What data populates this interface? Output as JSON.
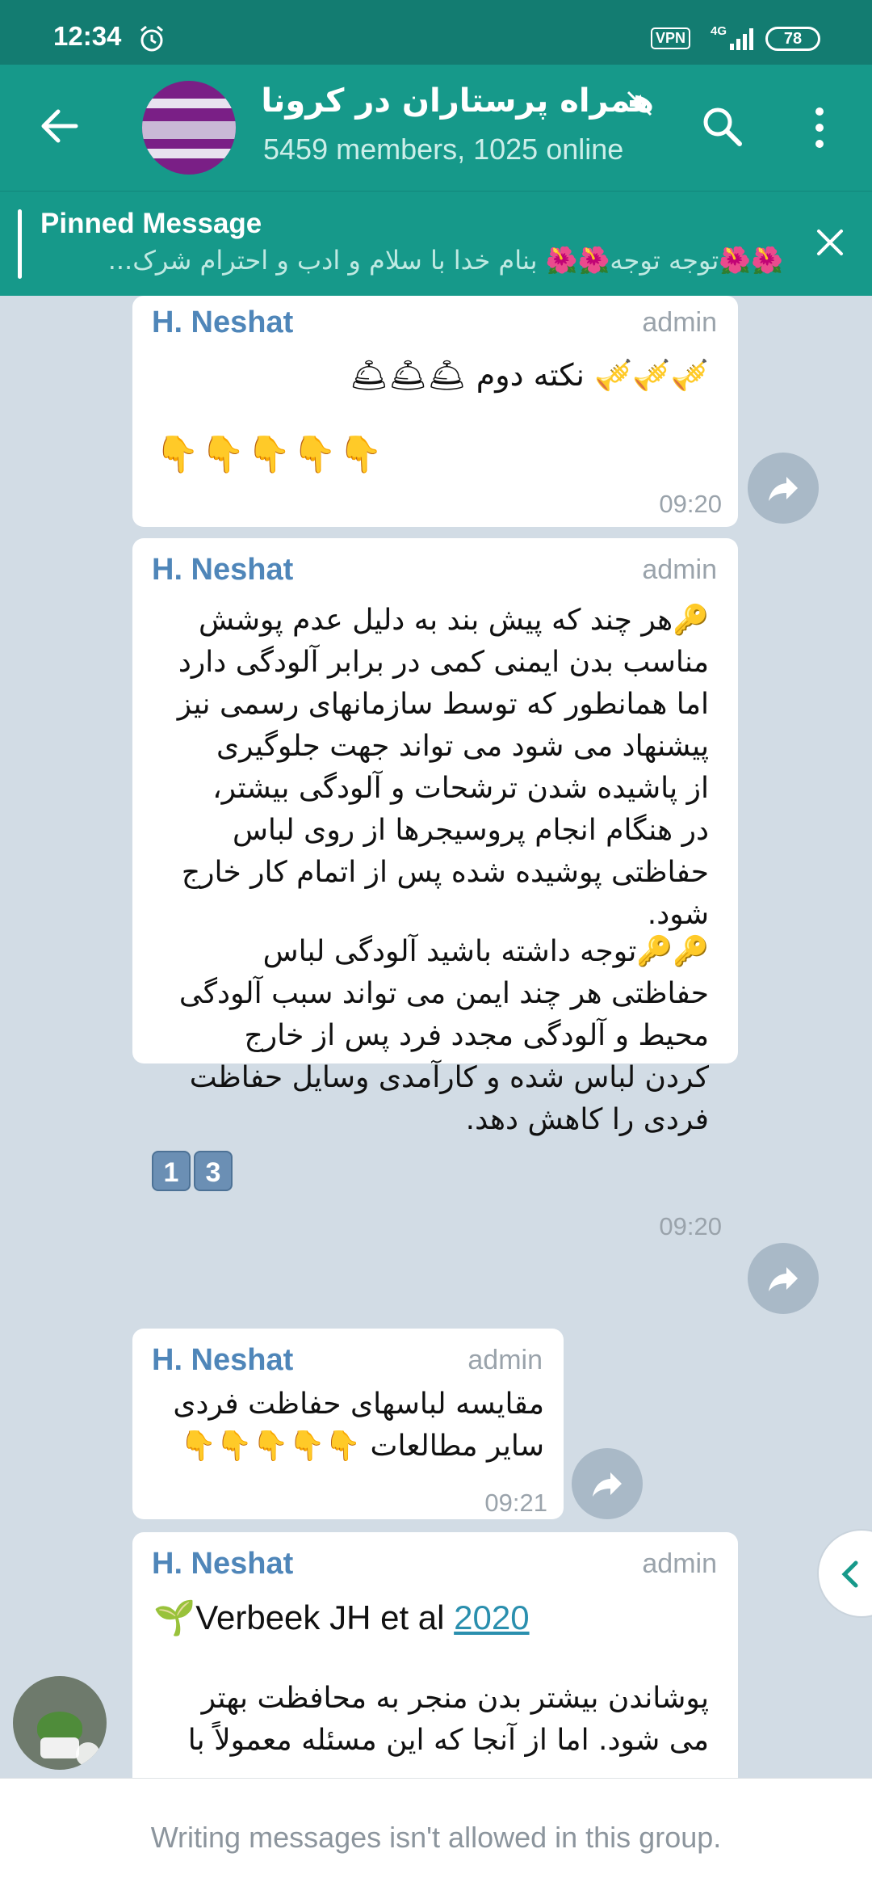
{
  "status_bar": {
    "time": "12:34",
    "vpn": "VPN",
    "network": "4G",
    "battery": "78"
  },
  "header": {
    "title": "همراه پرستاران در کرونا",
    "subtitle": "5459 members, 1025 online"
  },
  "pinned": {
    "title": "Pinned Message",
    "text": "🌺🌺توجه توجه🌺🌺  بنام خدا  با سلام و ادب و احترام  شرک..."
  },
  "messages": [
    {
      "sender": "H. Neshat",
      "role": "admin",
      "text": "🎺🎺🎺 نکته دوم 🛎🛎🛎",
      "emojis": "👇👇👇👇👇",
      "time": "09:20"
    },
    {
      "sender": "H. Neshat",
      "role": "admin",
      "paragraph1": "🔑هر چند که پیش بند به دلیل عدم پوشش\nمناسب بدن ایمنی کمی در برابر آلودگی دارد\nاما همانطور که توسط سازمانهای رسمی نیز\nپیشنهاد می شود می تواند جهت جلوگیری\nاز پاشیده شدن ترشحات و آلودگی بیشتر،\nدر هنگام انجام پروسیجرها از روی لباس\nحفاظتی پوشیده شده پس از اتمام کار خارج\nشود.",
      "paragraph2": "🔑🔑توجه داشته باشید آلودگی لباس\nحفاظتی هر چند ایمن می تواند سبب آلودگی\nمحیط و آلودگی مجدد فرد پس از خارج\nکردن لباس شده و کارآمدی وسایل حفاظت\nفردی را کاهش دهد.",
      "numbers": [
        "1",
        "3"
      ],
      "time": "09:20"
    },
    {
      "sender": "H. Neshat",
      "role": "admin",
      "text": "مقایسه لباسهای حفاظت فردی\nسایر مطالعات 👇👇👇👇👇",
      "time": "09:21"
    },
    {
      "sender": "H. Neshat",
      "role": "admin",
      "title_prefix": "🌱Verbeek JH et al ",
      "title_link": "2020",
      "text": "پوشاندن بیشتر بدن منجر به محافظت بهتر\nمی شود. اما از آنجا که این مسئله معمولاً با"
    }
  ],
  "footer": {
    "text": "Writing messages isn't allowed in this group."
  },
  "colors": {
    "header_bg": "#16998a",
    "status_bg": "#137c71",
    "chat_bg": "#d2dce5",
    "sender": "#4f86b9",
    "link": "#2a8fae"
  }
}
